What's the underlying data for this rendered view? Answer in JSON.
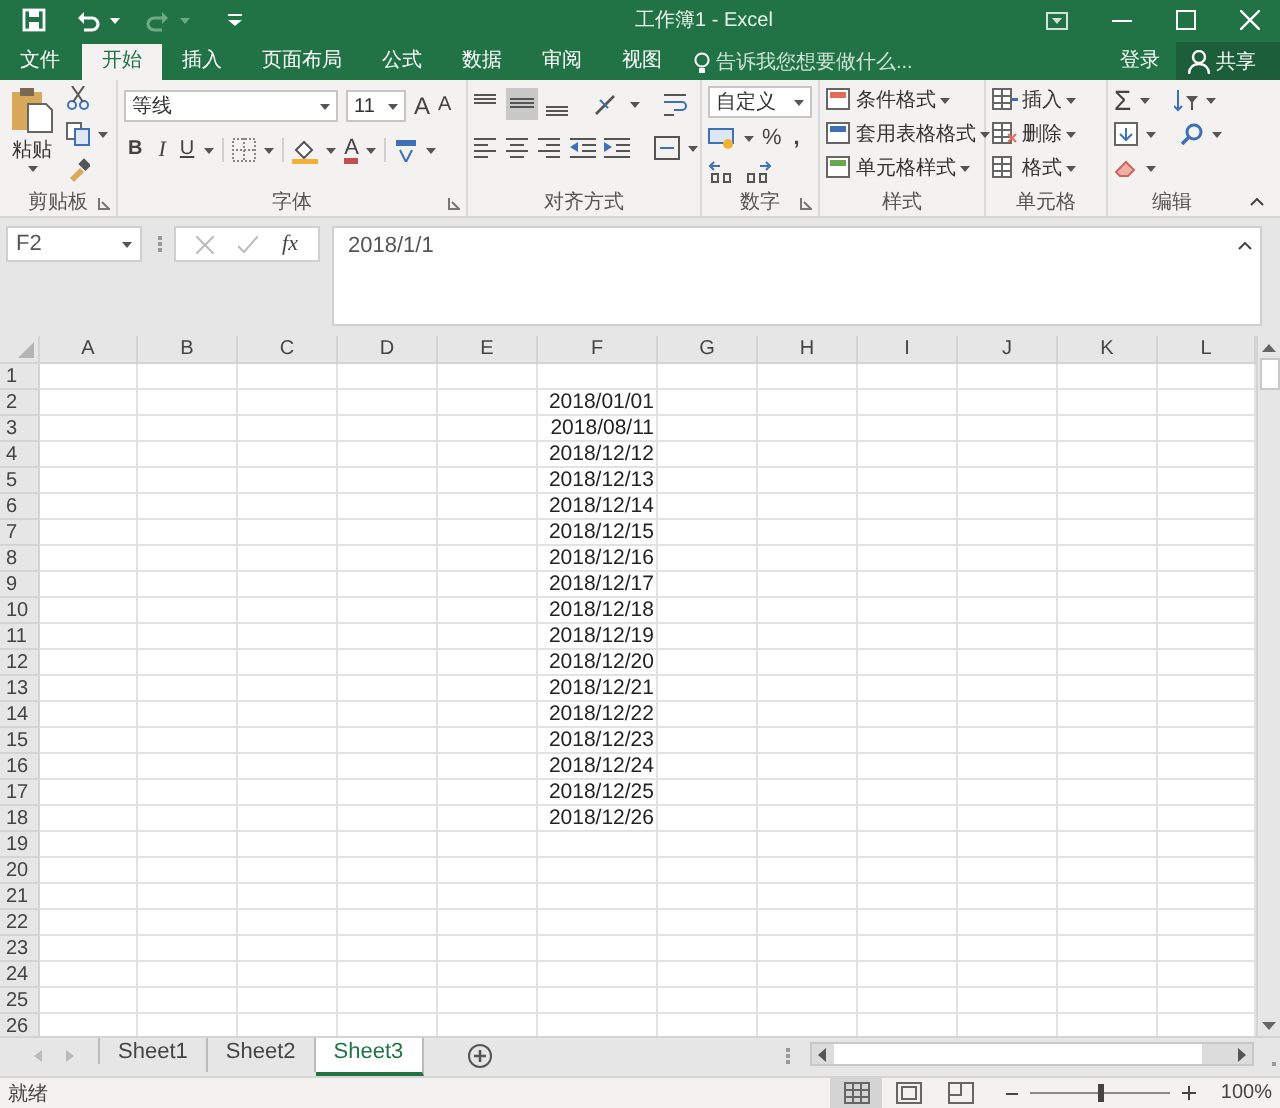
{
  "window": {
    "title": "工作簿1 - Excel"
  },
  "ribbon_tabs": [
    {
      "label": "文件",
      "selected": false
    },
    {
      "label": "开始",
      "selected": true
    },
    {
      "label": "插入",
      "selected": false
    },
    {
      "label": "页面布局",
      "selected": false
    },
    {
      "label": "公式",
      "selected": false
    },
    {
      "label": "数据",
      "selected": false
    },
    {
      "label": "审阅",
      "selected": false
    },
    {
      "label": "视图",
      "selected": false
    }
  ],
  "tell_me": {
    "placeholder": "告诉我您想要做什么..."
  },
  "account": {
    "sign_in": "登录",
    "share": "共享"
  },
  "ribbon": {
    "groups": [
      {
        "kind": "clipboard",
        "label": "剪贴板",
        "paste": "粘贴"
      },
      {
        "kind": "font",
        "label": "字体",
        "font_name": "等线",
        "font_size": "11",
        "grow": "A",
        "shrink": "A",
        "bold": "B",
        "italic": "I",
        "underline": "U",
        "font_color": "A"
      },
      {
        "kind": "alignment",
        "label": "对齐方式"
      },
      {
        "kind": "number",
        "label": "数字",
        "format": "自定义",
        "percent": "%",
        "comma": ","
      },
      {
        "kind": "styles",
        "label": "样式",
        "buttons": [
          "条件格式",
          "套用表格格式",
          "单元格样式"
        ]
      },
      {
        "kind": "cells",
        "label": "单元格",
        "buttons": [
          "插入",
          "删除",
          "格式"
        ]
      },
      {
        "kind": "editing",
        "label": "编辑",
        "sum": "Σ"
      }
    ]
  },
  "formula_bar": {
    "name_box": "F2",
    "fx": "fx",
    "value": "2018/1/1"
  },
  "sheet": {
    "columns": [
      "A",
      "B",
      "C",
      "D",
      "E",
      "F",
      "G",
      "H",
      "I",
      "J",
      "K",
      "L"
    ],
    "rows": [
      {
        "header": "1"
      },
      {
        "header": "2",
        "value": "2018/01/01"
      },
      {
        "header": "3",
        "value": "2018/08/11"
      },
      {
        "header": "4",
        "value": "2018/12/12"
      },
      {
        "header": "5",
        "value": "2018/12/13"
      },
      {
        "header": "6",
        "value": "2018/12/14"
      },
      {
        "header": "7",
        "value": "2018/12/15"
      },
      {
        "header": "8",
        "value": "2018/12/16"
      },
      {
        "header": "9",
        "value": "2018/12/17"
      },
      {
        "header": "10",
        "value": "2018/12/18"
      },
      {
        "header": "11",
        "value": "2018/12/19"
      },
      {
        "header": "12",
        "value": "2018/12/20"
      },
      {
        "header": "13",
        "value": "2018/12/21"
      },
      {
        "header": "14",
        "value": "2018/12/22"
      },
      {
        "header": "15",
        "value": "2018/12/23"
      },
      {
        "header": "16",
        "value": "2018/12/24"
      },
      {
        "header": "17",
        "value": "2018/12/25"
      },
      {
        "header": "18",
        "value": "2018/12/26"
      },
      {
        "header": "19"
      },
      {
        "header": "20"
      },
      {
        "header": "21"
      },
      {
        "header": "22"
      },
      {
        "header": "23"
      },
      {
        "header": "24"
      },
      {
        "header": "25"
      },
      {
        "header": "26"
      }
    ]
  },
  "sheet_tabs": [
    {
      "label": "Sheet1",
      "selected": false
    },
    {
      "label": "Sheet2",
      "selected": false
    },
    {
      "label": "Sheet3",
      "selected": true
    }
  ],
  "status_bar": {
    "status": "就绪",
    "views": [
      {
        "kind": "normal",
        "selected": true
      },
      {
        "kind": "page_layout",
        "selected": false
      },
      {
        "kind": "page_break",
        "selected": false
      }
    ],
    "zoom": {
      "level": 0.5
    },
    "zoom_label": "100%"
  }
}
